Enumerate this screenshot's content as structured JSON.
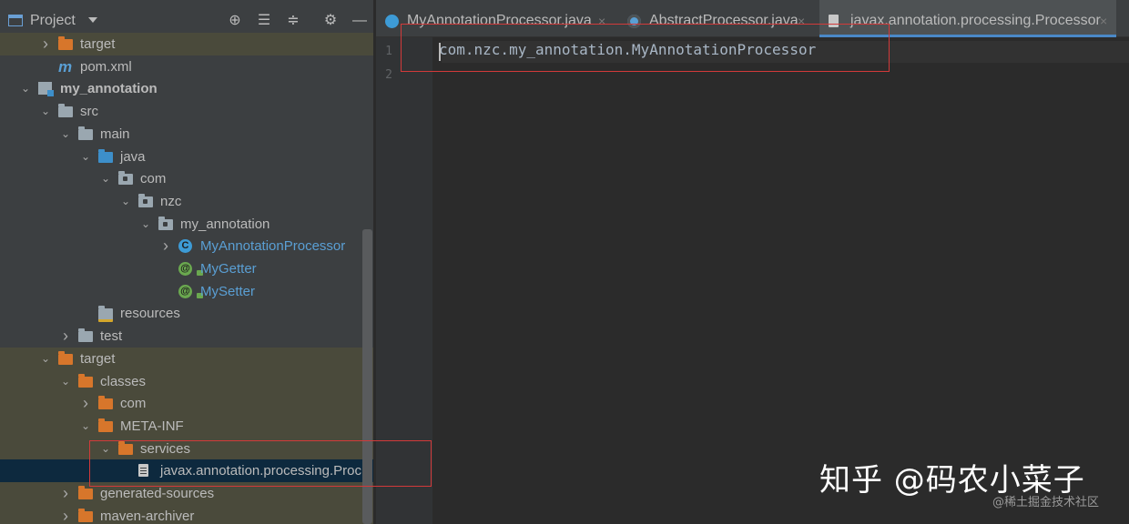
{
  "panel": {
    "title": "Project",
    "header_buttons": [
      "crosshair-icon",
      "expand-all-icon",
      "collapse-all-icon",
      "gear-icon",
      "minimize-icon"
    ]
  },
  "tree": [
    {
      "label": "target",
      "icon": "folder-orange",
      "arrow": "collapsed",
      "shaded": true,
      "color": "#bbbbbb"
    },
    {
      "label": "pom.xml",
      "icon": "maven-icon",
      "arrow": "none",
      "shaded": false,
      "color": "#bbbbbb"
    },
    {
      "label": "my_annotation",
      "icon": "module-icon",
      "arrow": "expanded",
      "shaded": false,
      "bold": true,
      "color": "#bbbbbb"
    },
    {
      "label": "src",
      "icon": "folder-grey",
      "arrow": "expanded",
      "shaded": false,
      "color": "#bbbbbb"
    },
    {
      "label": "main",
      "icon": "folder-grey",
      "arrow": "expanded",
      "shaded": false,
      "color": "#bbbbbb"
    },
    {
      "label": "java",
      "icon": "folder-blue",
      "arrow": "expanded",
      "shaded": false,
      "color": "#bbbbbb"
    },
    {
      "label": "com",
      "icon": "package-icon",
      "arrow": "expanded",
      "shaded": false,
      "color": "#bbbbbb"
    },
    {
      "label": "nzc",
      "icon": "package-icon",
      "arrow": "expanded",
      "shaded": false,
      "color": "#bbbbbb"
    },
    {
      "label": "my_annotation",
      "icon": "package-icon",
      "arrow": "expanded",
      "shaded": false,
      "color": "#bbbbbb"
    },
    {
      "label": "MyAnnotationProcessor",
      "icon": "class-icon",
      "arrow": "collapsed",
      "shaded": false,
      "color": "#5a9fd4"
    },
    {
      "label": "MyGetter",
      "icon": "annotation-icon",
      "arrow": "none",
      "shaded": false,
      "color": "#5a9fd4"
    },
    {
      "label": "MySetter",
      "icon": "annotation-icon",
      "arrow": "none",
      "shaded": false,
      "color": "#5a9fd4"
    },
    {
      "label": "resources",
      "icon": "resources-folder-icon",
      "arrow": "none",
      "shaded": false,
      "color": "#bbbbbb"
    },
    {
      "label": "test",
      "icon": "folder-grey",
      "arrow": "collapsed",
      "shaded": false,
      "color": "#bbbbbb"
    },
    {
      "label": "target",
      "icon": "folder-orange",
      "arrow": "expanded",
      "shaded": true,
      "color": "#bbbbbb"
    },
    {
      "label": "classes",
      "icon": "folder-orange",
      "arrow": "expanded",
      "shaded": true,
      "color": "#bbbbbb"
    },
    {
      "label": "com",
      "icon": "folder-orange",
      "arrow": "collapsed",
      "shaded": true,
      "color": "#bbbbbb"
    },
    {
      "label": "META-INF",
      "icon": "folder-orange",
      "arrow": "expanded",
      "shaded": true,
      "color": "#bbbbbb"
    },
    {
      "label": "services",
      "icon": "folder-orange",
      "arrow": "expanded",
      "shaded": true,
      "color": "#bbbbbb"
    },
    {
      "label": "javax.annotation.processing.Proc",
      "icon": "text-file-icon",
      "arrow": "none",
      "selected": true,
      "color": "#bbbbbb"
    },
    {
      "label": "generated-sources",
      "icon": "folder-orange",
      "arrow": "collapsed",
      "shaded": true,
      "color": "#bbbbbb"
    },
    {
      "label": "maven-archiver",
      "icon": "folder-orange",
      "arrow": "collapsed",
      "shaded": true,
      "color": "#bbbbbb"
    }
  ],
  "tabs": [
    {
      "label": "MyAnnotationProcessor.java",
      "icon": "class-icon",
      "active": false
    },
    {
      "label": "AbstractProcessor.java",
      "icon": "abstract-class-icon",
      "active": false
    },
    {
      "label": "javax.annotation.processing.Processor",
      "icon": "text-file-icon",
      "active": true
    }
  ],
  "editor": {
    "line_numbers": [
      "1",
      "2"
    ],
    "lines": [
      "com.nzc.my_annotation.MyAnnotationProcessor",
      ""
    ]
  },
  "watermark": {
    "main": "知乎 @码农小菜子",
    "sub": "@稀土掘金技术社区"
  },
  "colors": {
    "highlight_box": "#d23a3a",
    "tab_underline": "#4a88c7",
    "class_text": "#5a9fd4"
  }
}
